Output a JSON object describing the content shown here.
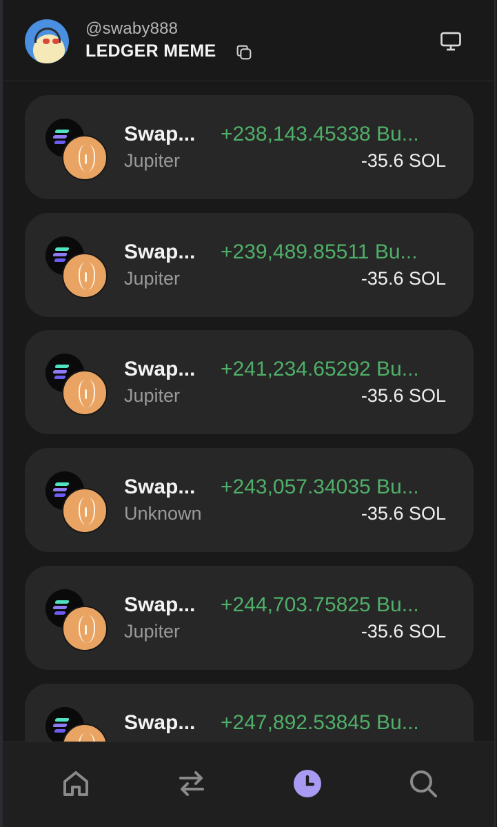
{
  "header": {
    "handle": "@swaby888",
    "wallet_name": "LEDGER MEME",
    "icons": {
      "copy": "copy-icon",
      "monitor": "monitor-icon"
    }
  },
  "transactions": [
    {
      "title": "Swap...",
      "source": "Jupiter",
      "amount": "+238,143.45338 Bu...",
      "cost": "-35.6 SOL"
    },
    {
      "title": "Swap...",
      "source": "Jupiter",
      "amount": "+239,489.85511 Bu...",
      "cost": "-35.6 SOL"
    },
    {
      "title": "Swap...",
      "source": "Jupiter",
      "amount": "+241,234.65292 Bu...",
      "cost": "-35.6 SOL"
    },
    {
      "title": "Swap...",
      "source": "Unknown",
      "amount": "+243,057.34035 Bu...",
      "cost": "-35.6 SOL"
    },
    {
      "title": "Swap...",
      "source": "Jupiter",
      "amount": "+244,703.75825 Bu...",
      "cost": "-35.6 SOL"
    },
    {
      "title": "Swap...",
      "source": "",
      "amount": "+247,892.53845 Bu...",
      "cost": ""
    }
  ],
  "nav": {
    "items": [
      "home-icon",
      "swap-arrows-icon",
      "history-clock-icon",
      "search-icon"
    ],
    "active": "history-clock-icon"
  },
  "colors": {
    "background": "#191919",
    "card": "#272727",
    "positive": "#4faf68",
    "accent": "#a99bf2",
    "muted": "#9a9a9a"
  }
}
